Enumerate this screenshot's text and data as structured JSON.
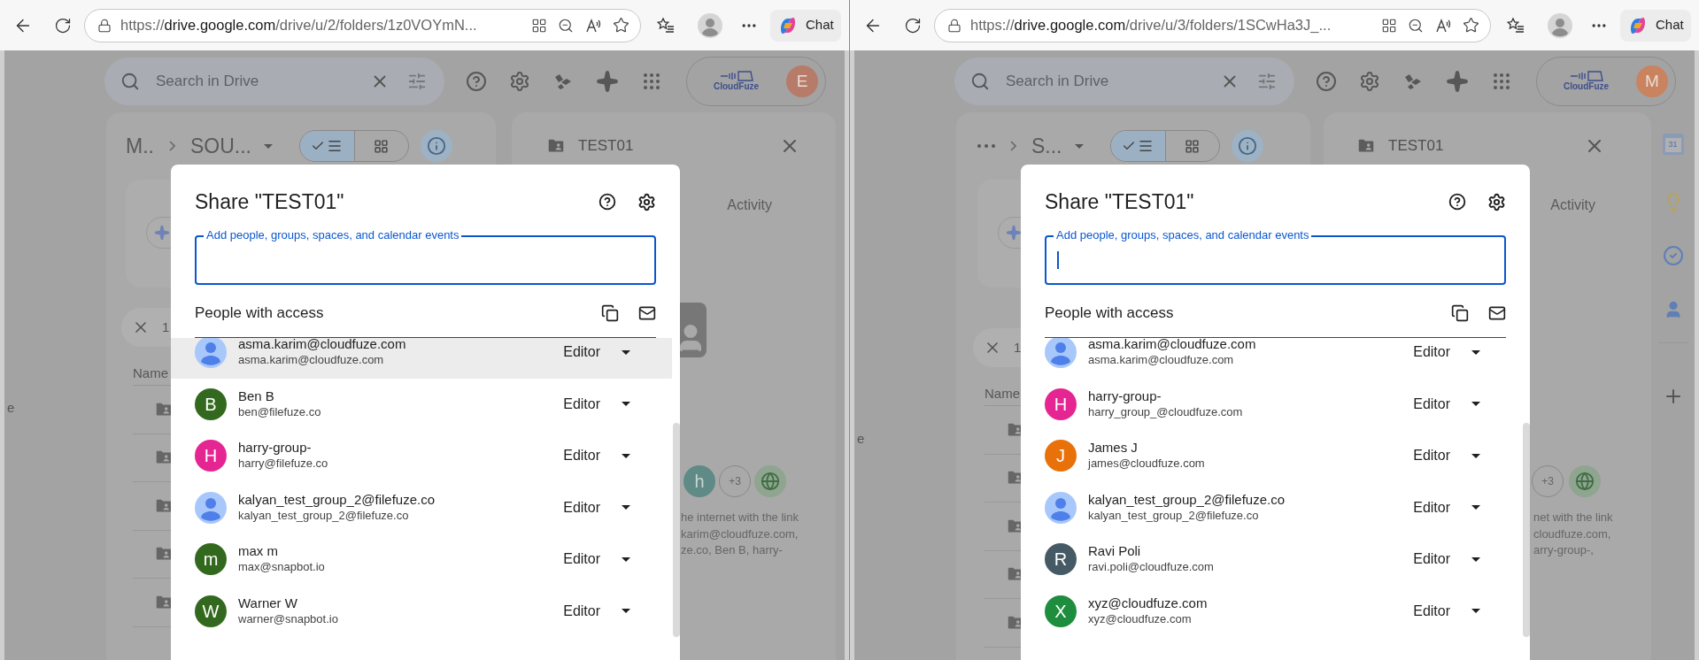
{
  "panes": [
    {
      "browser": {
        "url": "https://**drive.google.com**/drive/u/2/folders/1z0VOYmN...",
        "chat_label": "Chat"
      },
      "drive": {
        "search_placeholder": "Search in Drive",
        "logo_text": "CloudFuze",
        "account_avatar": {
          "initial": "E",
          "color": "#b77b69"
        },
        "breadcrumb": [
          {
            "kind": "text",
            "label": "M..",
            "dropdown": false
          },
          {
            "kind": "text",
            "label": "SOU...",
            "dropdown": true
          }
        ],
        "view_modes": [
          {
            "kind": "list",
            "selected": true
          },
          {
            "kind": "grid",
            "selected": false
          }
        ],
        "filter_chip": "1",
        "column_header": "Name",
        "side_text": "e",
        "details": {
          "title": "TEST01",
          "tab": "Activity",
          "preview_icon": true,
          "shared_avatars": [
            {
              "kind": "letter",
              "label": "h",
              "color": "#5f8a86"
            },
            {
              "kind": "count",
              "label": "+3"
            },
            {
              "kind": "globe"
            }
          ],
          "access_lines": [
            "he internet with the link",
            "karim@cloudfuze.com,",
            "ze.co, Ben B, harry-"
          ]
        }
      },
      "dialog": {
        "title": "Share \"TEST01\"",
        "input_label": "Add people, groups, spaces, and calendar events",
        "section": "People with access",
        "people": [
          {
            "kind": "photo",
            "name": "asma.karim@cloudfuze.com",
            "email": "asma.karim@cloudfuze.com",
            "role": "Editor",
            "hovered": true
          },
          {
            "kind": "letter",
            "letter": "B",
            "color": "#33691e",
            "name": "Ben B",
            "email": "ben@filefuze.co",
            "role": "Editor",
            "hovered": false
          },
          {
            "kind": "letter",
            "letter": "H",
            "color": "#e52592",
            "name": "harry-group-",
            "email": "harry@filefuze.co",
            "role": "Editor",
            "hovered": false
          },
          {
            "kind": "photo",
            "name": "kalyan_test_group_2@filefuze.co",
            "email": "kalyan_test_group_2@filefuze.co",
            "role": "Editor",
            "hovered": false
          },
          {
            "kind": "letter",
            "letter": "m",
            "color": "#33691e",
            "name": "max m",
            "email": "max@snapbot.io",
            "role": "Editor",
            "hovered": false
          },
          {
            "kind": "letter",
            "letter": "W",
            "color": "#33691e",
            "name": "Warner W",
            "email": "warner@snapbot.io",
            "role": "Editor",
            "hovered": false
          }
        ]
      }
    },
    {
      "browser": {
        "url": "https://**drive.google.com**/drive/u/3/folders/1SCwHa3J_...",
        "chat_label": "Chat"
      },
      "drive": {
        "search_placeholder": "Search in Drive",
        "logo_text": "CloudFuze",
        "account_avatar": {
          "initial": "M",
          "color": "#c9835f"
        },
        "breadcrumb": [
          {
            "kind": "more"
          },
          {
            "kind": "text",
            "label": "S...",
            "dropdown": true
          }
        ],
        "view_modes": [
          {
            "kind": "list",
            "selected": true
          },
          {
            "kind": "grid",
            "selected": false
          }
        ],
        "filter_chip": "1",
        "column_header": "Name",
        "side_text": "e",
        "details": {
          "title": "TEST01",
          "tab": "Activity",
          "shared_avatars": [
            {
              "kind": "count",
              "label": "+3"
            },
            {
              "kind": "globe"
            }
          ],
          "access_lines": [
            "net with the link",
            "cloudfuze.com,",
            "arry-group-,"
          ]
        },
        "side_apps": [
          {
            "kind": "calendar",
            "label": "31"
          },
          {
            "kind": "keep"
          },
          {
            "kind": "tasks"
          },
          {
            "kind": "contacts"
          },
          {
            "kind": "add"
          }
        ]
      },
      "dialog": {
        "title": "Share \"TEST01\"",
        "input_label": "Add people, groups, spaces, and calendar events",
        "caret": true,
        "section": "People with access",
        "people": [
          {
            "kind": "photo",
            "name": "asma.karim@cloudfuze.com",
            "email": "asma.karim@cloudfuze.com",
            "role": "Editor",
            "hovered": false
          },
          {
            "kind": "letter",
            "letter": "H",
            "color": "#e52592",
            "name": "harry-group-",
            "email": "harry_group_@cloudfuze.com",
            "role": "Editor",
            "hovered": false
          },
          {
            "kind": "letter",
            "letter": "J",
            "color": "#e8710a",
            "name": "James J",
            "email": "james@cloudfuze.com",
            "role": "Editor",
            "hovered": false
          },
          {
            "kind": "photo",
            "name": "kalyan_test_group_2@filefuze.co",
            "email": "kalyan_test_group_2@filefuze.co",
            "role": "Editor",
            "hovered": false
          },
          {
            "kind": "letter",
            "letter": "R",
            "color": "#455a64",
            "name": "Ravi Poli",
            "email": "ravi.poli@cloudfuze.com",
            "role": "Editor",
            "hovered": false
          },
          {
            "kind": "letter",
            "letter": "X",
            "color": "#1e8e3e",
            "name": "xyz@cloudfuze.com",
            "email": "xyz@cloudfuze.com",
            "role": "Editor",
            "hovered": false
          }
        ]
      }
    }
  ]
}
